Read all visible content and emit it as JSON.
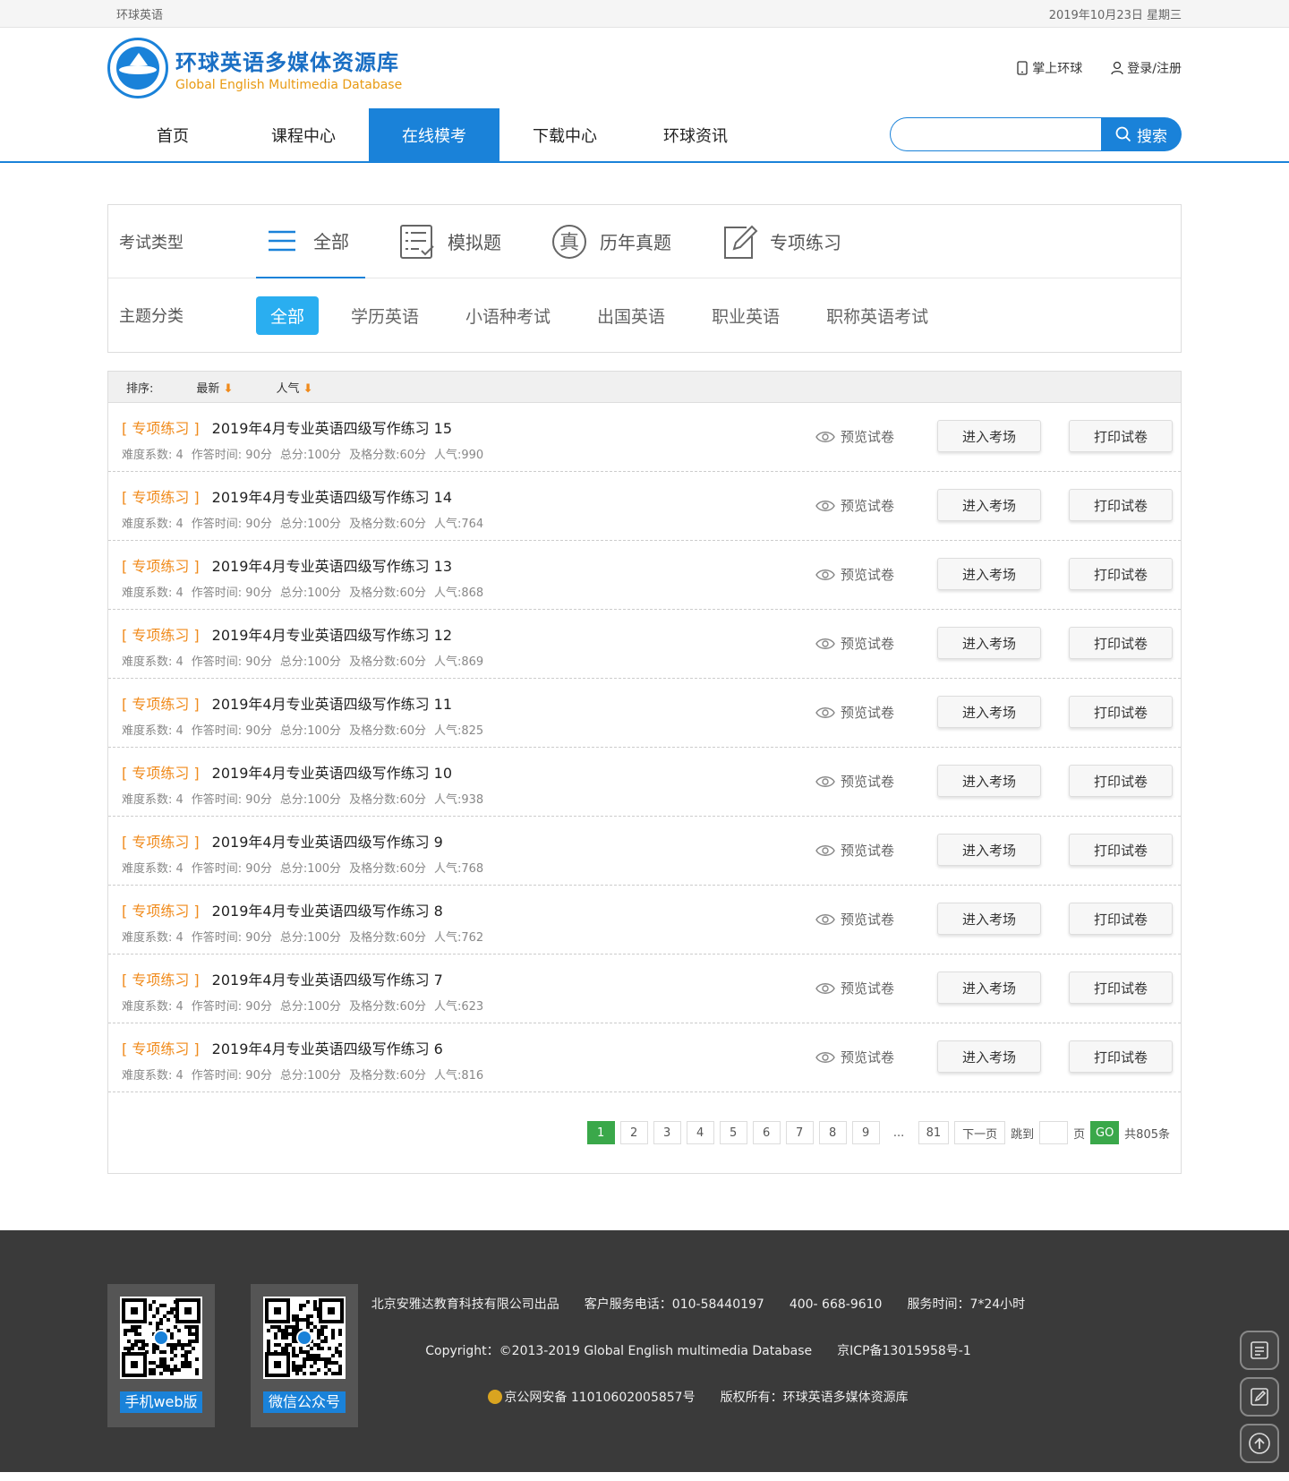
{
  "topbar": {
    "site_name": "环球英语",
    "date": "2019年10月23日 星期三"
  },
  "logo": {
    "cn": "环球英语多媒体资源库",
    "en": "Global English Multimedia Database"
  },
  "header_links": {
    "mobile": "掌上环球",
    "login": "登录/注册"
  },
  "nav": [
    "首页",
    "课程中心",
    "在线模考",
    "下载中心",
    "环球资讯"
  ],
  "search": {
    "placeholder": "",
    "button": "搜索"
  },
  "filter": {
    "type_label": "考试类型",
    "types": [
      "全部",
      "模拟题",
      "历年真题",
      "专项练习"
    ],
    "topic_label": "主题分类",
    "topics": [
      "全部",
      "学历英语",
      "小语种考试",
      "出国英语",
      "职业英语",
      "职称英语考试"
    ]
  },
  "sort": {
    "label": "排序:",
    "newest": "最新",
    "popular": "人气",
    "arrow": "⬇"
  },
  "rows": [
    {
      "tag": "[ 专项练习 ]",
      "title": "2019年4月专业英语四级写作练习 15",
      "difficulty": "难度系数: 4",
      "time": "作答时间: 90分",
      "total": "总分:100分",
      "pass": "及格分数:60分",
      "popularity": "人气:990"
    },
    {
      "tag": "[ 专项练习 ]",
      "title": "2019年4月专业英语四级写作练习 14",
      "difficulty": "难度系数: 4",
      "time": "作答时间: 90分",
      "total": "总分:100分",
      "pass": "及格分数:60分",
      "popularity": "人气:764"
    },
    {
      "tag": "[ 专项练习 ]",
      "title": "2019年4月专业英语四级写作练习 13",
      "difficulty": "难度系数: 4",
      "time": "作答时间: 90分",
      "total": "总分:100分",
      "pass": "及格分数:60分",
      "popularity": "人气:868"
    },
    {
      "tag": "[ 专项练习 ]",
      "title": "2019年4月专业英语四级写作练习 12",
      "difficulty": "难度系数: 4",
      "time": "作答时间: 90分",
      "total": "总分:100分",
      "pass": "及格分数:60分",
      "popularity": "人气:869"
    },
    {
      "tag": "[ 专项练习 ]",
      "title": "2019年4月专业英语四级写作练习 11",
      "difficulty": "难度系数: 4",
      "time": "作答时间: 90分",
      "total": "总分:100分",
      "pass": "及格分数:60分",
      "popularity": "人气:825"
    },
    {
      "tag": "[ 专项练习 ]",
      "title": "2019年4月专业英语四级写作练习 10",
      "difficulty": "难度系数: 4",
      "time": "作答时间: 90分",
      "total": "总分:100分",
      "pass": "及格分数:60分",
      "popularity": "人气:938"
    },
    {
      "tag": "[ 专项练习 ]",
      "title": "2019年4月专业英语四级写作练习 9",
      "difficulty": "难度系数: 4",
      "time": "作答时间: 90分",
      "total": "总分:100分",
      "pass": "及格分数:60分",
      "popularity": "人气:768"
    },
    {
      "tag": "[ 专项练习 ]",
      "title": "2019年4月专业英语四级写作练习 8",
      "difficulty": "难度系数: 4",
      "time": "作答时间: 90分",
      "total": "总分:100分",
      "pass": "及格分数:60分",
      "popularity": "人气:762"
    },
    {
      "tag": "[ 专项练习 ]",
      "title": "2019年4月专业英语四级写作练习 7",
      "difficulty": "难度系数: 4",
      "time": "作答时间: 90分",
      "total": "总分:100分",
      "pass": "及格分数:60分",
      "popularity": "人气:623"
    },
    {
      "tag": "[ 专项练习 ]",
      "title": "2019年4月专业英语四级写作练习 6",
      "difficulty": "难度系数: 4",
      "time": "作答时间: 90分",
      "total": "总分:100分",
      "pass": "及格分数:60分",
      "popularity": "人气:816"
    }
  ],
  "row_actions": {
    "preview": "预览试卷",
    "enter": "进入考场",
    "print": "打印试卷"
  },
  "pager": {
    "pages": [
      "1",
      "2",
      "3",
      "4",
      "5",
      "6",
      "7",
      "8",
      "9"
    ],
    "dots": "...",
    "last": "81",
    "next": "下一页",
    "jump": "跳到",
    "page_unit": "页",
    "go": "GO",
    "total": "共805条"
  },
  "footer": {
    "qr1_label": "手机web版",
    "qr2_label": "微信公众号",
    "line1": "北京安雅达教育科技有限公司出品　　客户服务电话：010-58440197　　400- 668-9610　　服务时间：7*24小时",
    "line2": "Copyright：©2013-2019 Global English multimedia Database　　京ICP备13015958号-1",
    "line3": "京公网安备 11010602005857号　　版权所有：环球英语多媒体资源库"
  },
  "colors": {
    "brand": "#1a82d9",
    "accent": "#f08a1a",
    "pager_active": "#3aa84a",
    "topic_active": "#2aaef0"
  }
}
